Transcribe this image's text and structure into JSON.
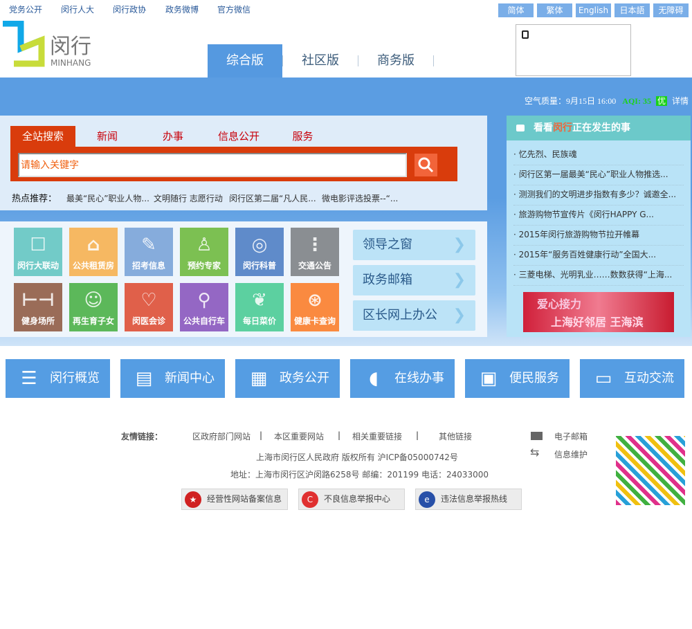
{
  "top_links": [
    "党务公开",
    "闵行人大",
    "闵行政协",
    "政务微博",
    "官方微信"
  ],
  "languages": [
    "简体",
    "繁体",
    "English",
    "日本語",
    "无障碍"
  ],
  "logo": {
    "cn": "闵行",
    "en": "MINHANG"
  },
  "version_tabs": [
    "综合版",
    "社区版",
    "商务版"
  ],
  "air": {
    "label": "空气质量：",
    "time": "9月15日 16:00",
    "aqi": "AQI: 35",
    "level": "优",
    "detail": "详情"
  },
  "search": {
    "tabs": [
      "全站搜索",
      "新闻",
      "办事",
      "信息公开",
      "服务"
    ],
    "placeholder": "请输入关键字",
    "hot_label": "热点推荐：",
    "hot": [
      "最美“民心”职业人物...",
      "文明随行 志愿行动",
      "闵行区第二届“凡人民...",
      "微电影评选投票--“..."
    ]
  },
  "tiles": [
    {
      "label": "闵行大联动",
      "icon": "minhang-logo-icon",
      "color": "#72cbc8"
    },
    {
      "label": "公共租赁房",
      "icon": "house-icon",
      "color": "#f6b862"
    },
    {
      "label": "招考信息",
      "icon": "edit-icon",
      "color": "#86acdc"
    },
    {
      "label": "预约专家",
      "icon": "doctor-icon",
      "color": "#7cc052"
    },
    {
      "label": "闵行科普",
      "icon": "science-icon",
      "color": "#5f8bca"
    },
    {
      "label": "交通公告",
      "icon": "traffic-light-icon",
      "color": "#8a8e92"
    },
    {
      "label": "健身场所",
      "icon": "dumbbell-icon",
      "color": "#9a6c58"
    },
    {
      "label": "再生育子女",
      "icon": "mother-child-icon",
      "color": "#5cb85a"
    },
    {
      "label": "闵医会诊",
      "icon": "stethoscope-icon",
      "color": "#e0604a"
    },
    {
      "label": "公共自行车",
      "icon": "bicycle-icon",
      "color": "#9467c4"
    },
    {
      "label": "每日菜价",
      "icon": "vegetable-icon",
      "color": "#5cd0a0"
    },
    {
      "label": "健康卡查询",
      "icon": "accessibility-icon",
      "color": "#fa8a40"
    }
  ],
  "side_buttons": [
    "领导之窗",
    "政务邮箱",
    "区长网上办公"
  ],
  "happening": {
    "pre": "看看",
    "hl": "闵行",
    "post": "正在发生的事",
    "items": [
      "忆先烈、民族魂",
      "闵行区第一届最美“民心”职业人物推选...",
      "测测我们的文明进步指数有多少？诚邀全...",
      "旅游购物节宣传片《闵行HAPPY G...",
      "2015年闵行旅游购物节拉开帷幕",
      "2015年“服务百姓健康行动”全国大...",
      "三菱电梯、光明乳业……数数获得“上海..."
    ],
    "banner": {
      "title": "爱心接力",
      "sub": "上海好邻居 王海滨"
    }
  },
  "nav": [
    "闵行概览",
    "新闻中心",
    "政务公开",
    "在线办事",
    "便民服务",
    "互动交流"
  ],
  "footer": {
    "links_label": "友情链接：",
    "links": [
      "区政府部门网站",
      "本区重要网站",
      "相关重要链接",
      "其他链接"
    ],
    "copyright": "上海市闵行区人民政府 版权所有 沪ICP备05000742号",
    "address": "地址：上海市闵行区沪闵路6258号 邮编：201199 电话：24033000",
    "email": "电子邮箱",
    "maintain": "信息维护",
    "badges": [
      "经营性网站备案信息",
      "不良信息举报中心",
      "违法信息举报热线"
    ]
  }
}
